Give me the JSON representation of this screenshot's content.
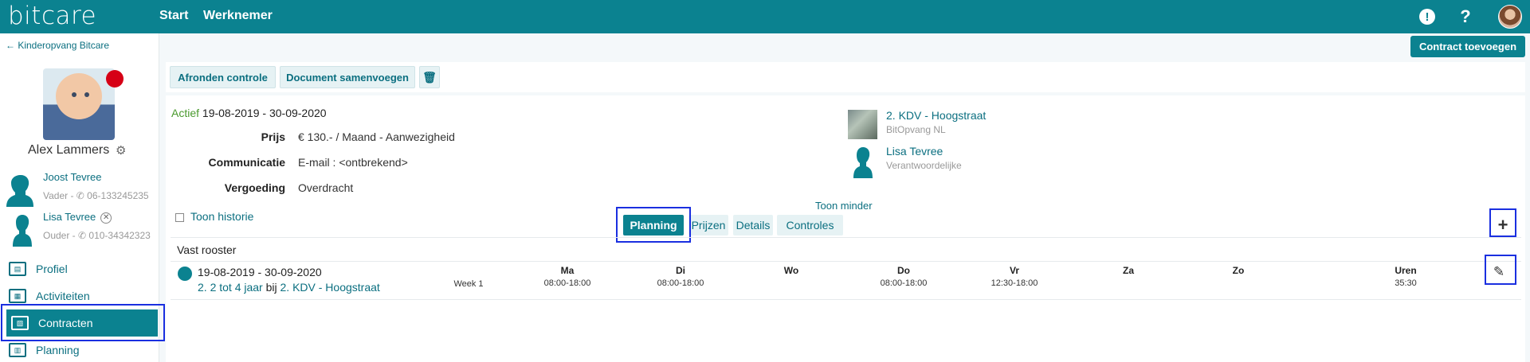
{
  "app": {
    "logo": "bitcare"
  },
  "nav": {
    "start": "Start",
    "werknemer": "Werknemer",
    "alert_icon": "!",
    "help_icon": "?"
  },
  "sidebar": {
    "back_label": "← Kinderopvang Bitcare",
    "child_name": "Alex Lammers",
    "status_color": "#d60016",
    "parents": [
      {
        "name": "Joost Tevree",
        "role": "Vader - ✆ 06-133245235"
      },
      {
        "name": "Lisa Tevree",
        "role": "Ouder - ✆ 010-34342323"
      }
    ],
    "items": [
      {
        "label": "Profiel",
        "icon": "profile-card-icon"
      },
      {
        "label": "Activiteiten",
        "icon": "table-icon"
      },
      {
        "label": "Contracten",
        "icon": "document-icon",
        "active": true
      },
      {
        "label": "Planning",
        "icon": "calendar-icon"
      }
    ]
  },
  "toolbar": {
    "add_contract": "Contract toevoegen",
    "finish_check": "Afronden controle",
    "merge_document": "Document samenvoegen",
    "delete_icon": "trash-icon"
  },
  "contract": {
    "status": "Actief",
    "period": "19-08-2019 - 30-09-2020",
    "fields": [
      {
        "label": "Prijs",
        "value": "€ 130.- / Maand - Aanwezigheid"
      },
      {
        "label": "Communicatie",
        "value": "E-mail : <ontbrekend>"
      },
      {
        "label": "Vergoeding",
        "value": "Overdracht"
      }
    ],
    "location": {
      "name": "2. KDV - Hoogstraat",
      "organisation": "BitOpvang NL"
    },
    "responsible": {
      "name": "Lisa Tevree",
      "role": "Verantwoordelijke"
    },
    "toon_minder": "Toon minder",
    "toon_historie": "Toon historie",
    "tabs": [
      {
        "label": "Planning",
        "active": true
      },
      {
        "label": "Prijzen"
      },
      {
        "label": "Details"
      },
      {
        "label": "Controles"
      }
    ]
  },
  "schedule": {
    "title": "Vast rooster",
    "period": "19-08-2019 - 30-09-2020",
    "group_prefix": "2. 2 tot 4 jaar",
    "group_joiner": "bij",
    "group_location": "2. KDV - Hoogstraat",
    "week": "Week 1",
    "days": [
      {
        "name": "Ma",
        "time": "08:00-18:00"
      },
      {
        "name": "Di",
        "time": "08:00-18:00"
      },
      {
        "name": "Wo",
        "time": ""
      },
      {
        "name": "Do",
        "time": "08:00-18:00"
      },
      {
        "name": "Vr",
        "time": "12:30-18:00"
      },
      {
        "name": "Za",
        "time": ""
      },
      {
        "name": "Zo",
        "time": ""
      },
      {
        "name": "Uren",
        "time": "35:30"
      }
    ]
  },
  "colors": {
    "brand": "#0b8290",
    "link": "#0b6f80",
    "active_green": "#4a9a2e",
    "highlight": "#1a2fe0"
  }
}
